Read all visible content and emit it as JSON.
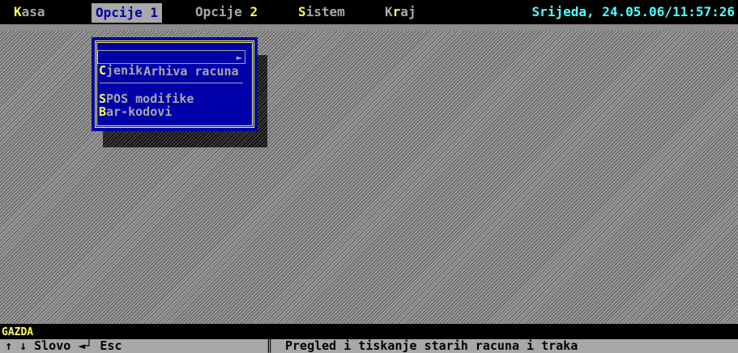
{
  "menubar": {
    "items": [
      {
        "hotkey": "K",
        "rest": "asa"
      },
      {
        "hotkey": "",
        "rest": "Opcije 1"
      },
      {
        "pre": "Opcije ",
        "hotkey": "2"
      },
      {
        "hotkey": "S",
        "rest": "istem"
      },
      {
        "pre": "K",
        "hotkey": "r",
        "rest": "aj"
      }
    ],
    "clock": "Srijeda, 24.05.06/11:57:26"
  },
  "dropdown": {
    "items": [
      {
        "hotkey": "",
        "rest": "Arhiva racuna",
        "arrow": "►"
      },
      {
        "hotkey": "C",
        "rest": "jenik"
      },
      {
        "hotkey": "S",
        "rest": "POS modifike"
      },
      {
        "hotkey": "B",
        "rest": "ar-kodovi"
      }
    ]
  },
  "status": {
    "user": "GAZDA",
    "keys": "↑ ↓ Slovo ◄┘ Esc",
    "separator": "║",
    "message": "Pregled i tiskanje starih racuna i traka"
  },
  "colors": {
    "menu_bg": "#000000",
    "menu_text": "#a8a8a8",
    "hotkey": "#ffff55",
    "clock": "#55ffff",
    "dropdown_bg": "#0000a8",
    "status_bg": "#a8a8a8"
  }
}
